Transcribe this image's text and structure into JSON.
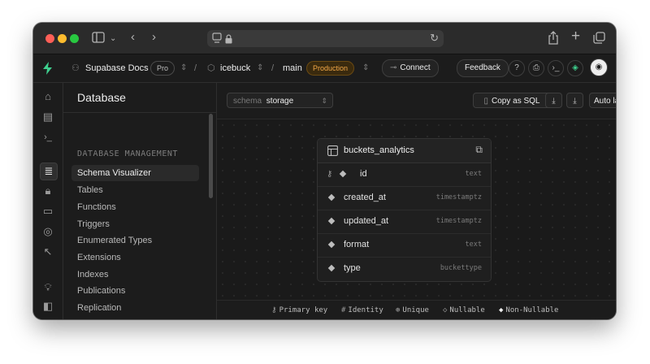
{
  "app": {
    "org_name": "Supabase Docs",
    "plan_badge": "Pro",
    "project_name": "icebuck",
    "branch_name": "main",
    "environment_badge": "Production",
    "connect_label": "Connect",
    "feedback_label": "Feedback"
  },
  "sidebar": {
    "title": "Database",
    "section_label": "DATABASE MANAGEMENT",
    "items": [
      {
        "label": "Schema Visualizer",
        "active": true
      },
      {
        "label": "Tables",
        "active": false
      },
      {
        "label": "Functions",
        "active": false
      },
      {
        "label": "Triggers",
        "active": false
      },
      {
        "label": "Enumerated Types",
        "active": false
      },
      {
        "label": "Extensions",
        "active": false
      },
      {
        "label": "Indexes",
        "active": false
      },
      {
        "label": "Publications",
        "active": false
      },
      {
        "label": "Replication",
        "active": false
      }
    ]
  },
  "toolbar": {
    "schema_prefix": "schema",
    "schema_value": "storage",
    "copy_sql_label": "Copy as SQL",
    "auto_layout_label": "Auto layout"
  },
  "table": {
    "name": "buckets_analytics",
    "columns": [
      {
        "name": "id",
        "type": "text",
        "primary_key": true
      },
      {
        "name": "created_at",
        "type": "timestamptz",
        "primary_key": false
      },
      {
        "name": "updated_at",
        "type": "timestamptz",
        "primary_key": false
      },
      {
        "name": "format",
        "type": "text",
        "primary_key": false
      },
      {
        "name": "type",
        "type": "buckettype",
        "primary_key": false
      }
    ]
  },
  "legend": {
    "primary_key": "Primary key",
    "identity": "Identity",
    "unique": "Unique",
    "nullable": "Nullable",
    "non_nullable": "Non-Nullable"
  },
  "colors": {
    "brand": "#3ecf8e",
    "production_badge": "#f3a847",
    "background": "#1c1c1c"
  }
}
